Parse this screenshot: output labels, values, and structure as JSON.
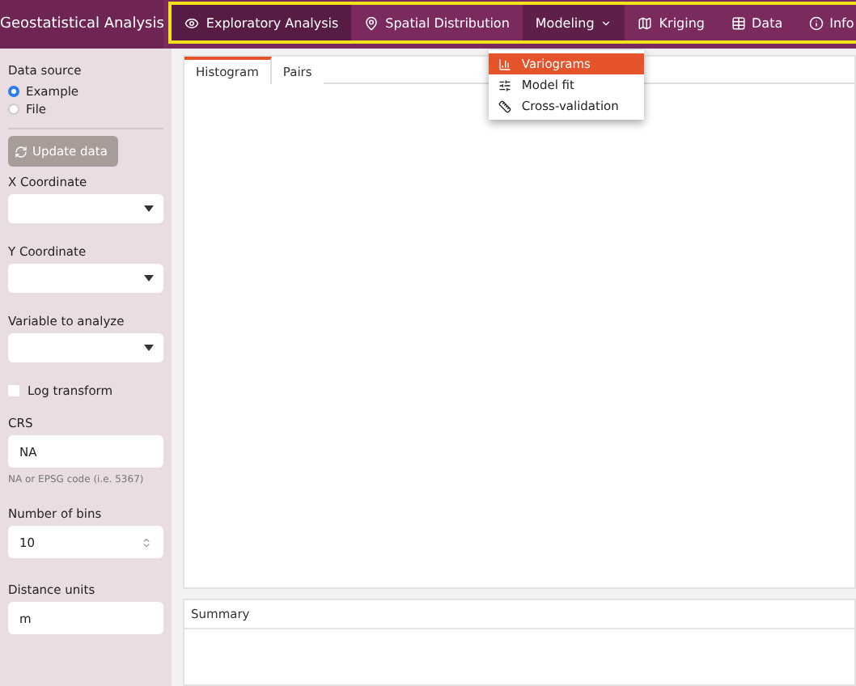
{
  "brand": "Geostatistical Analysis",
  "nav": [
    {
      "label": "Exploratory Analysis",
      "selected": true,
      "dropdown": false
    },
    {
      "label": "Spatial Distribution",
      "selected": false,
      "dropdown": false
    },
    {
      "label": "Modeling",
      "selected": false,
      "dropdown": true
    },
    {
      "label": "Kriging",
      "selected": false,
      "dropdown": false
    },
    {
      "label": "Data",
      "selected": false,
      "dropdown": false
    },
    {
      "label": "Info",
      "selected": false,
      "dropdown": false
    }
  ],
  "menu": [
    {
      "label": "Variograms",
      "selected": true
    },
    {
      "label": "Model fit",
      "selected": false
    },
    {
      "label": "Cross-validation",
      "selected": false
    }
  ],
  "sidebar": {
    "data_source": {
      "label": "Data source",
      "options": [
        {
          "label": "Example",
          "selected": true
        },
        {
          "label": "File",
          "selected": false
        }
      ]
    },
    "update_button": "Update data",
    "selects": [
      {
        "label": "X Coordinate"
      },
      {
        "label": "Y Coordinate"
      },
      {
        "label": "Variable to analyze"
      }
    ],
    "log_transform": {
      "label": "Log transform",
      "checked": false
    },
    "crs": {
      "label": "CRS",
      "value": "NA",
      "help": "NA or EPSG code (i.e. 5367)"
    },
    "bins": {
      "label": "Number of bins",
      "value": "10"
    },
    "units": {
      "label": "Distance units",
      "value": "m"
    }
  },
  "tabs": [
    {
      "label": "Histogram",
      "selected": true
    },
    {
      "label": "Pairs",
      "selected": false
    }
  ],
  "summary": {
    "title": "Summary"
  }
}
